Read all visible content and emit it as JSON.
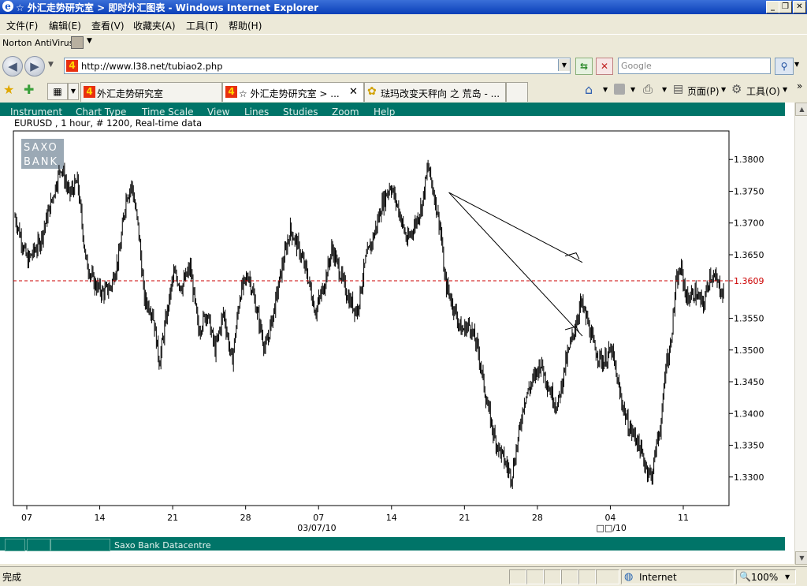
{
  "window": {
    "title": "☆ 外汇走势研究室 > 即时外汇图表 - Windows Internet Explorer",
    "icon": "e"
  },
  "menu": {
    "items": [
      "文件(F)",
      "编辑(E)",
      "查看(V)",
      "收藏夹(A)",
      "工具(T)",
      "帮助(H)"
    ]
  },
  "norton": {
    "label": "Norton AntiVirus"
  },
  "address": {
    "url": "http://www.l38.net/tubiao2.php",
    "search_placeholder": "Google"
  },
  "tabs": [
    {
      "label": "外汇走势研究室",
      "active": false,
      "favicon": "4"
    },
    {
      "label": "☆ 外汇走势研究室 > ...",
      "active": true,
      "favicon": "4"
    },
    {
      "label": "琺玛改变天秤向 之 荒岛 - ...",
      "active": false,
      "favicon": "✿"
    }
  ],
  "right_toolbar": {
    "page_label": "页面(P)",
    "tools_label": "工具(O)"
  },
  "chart_menu": [
    "Instrument",
    "Chart Type",
    "Time Scale",
    "View",
    "Lines",
    "Studies",
    "Zoom",
    "Help"
  ],
  "chart_info": "EURUSD , 1 hour, # 1200, Real-time data",
  "watermark": [
    "SAXO",
    "BANK"
  ],
  "bottom_bar": {
    "label": "Saxo Bank Datacentre"
  },
  "status": {
    "text": "完成",
    "zone": "Internet",
    "zoom": "100%"
  },
  "chart_data": {
    "type": "ohlc",
    "instrument": "EURUSD",
    "xlabel_months": [
      {
        "label": "03/07/10",
        "tick": "07"
      },
      {
        "label": "□□/10",
        "tick": "04"
      }
    ],
    "x_ticks": [
      "07",
      "14",
      "21",
      "28",
      "07",
      "14",
      "21",
      "28",
      "04",
      "11"
    ],
    "y_ticks": [
      1.38,
      1.375,
      1.37,
      1.365,
      1.355,
      1.35,
      1.345,
      1.34,
      1.335,
      1.33
    ],
    "y_tick_labels": [
      "1.3800",
      "1.3750",
      "1.3700",
      "1.3650",
      "1.3550",
      "1.3500",
      "1.3450",
      "1.3400",
      "1.3350",
      "1.3300"
    ],
    "ylim": [
      1.3255,
      1.3845
    ],
    "current_price": 1.3609,
    "current_price_label": "1.3609",
    "current_price_color": "#cc0000",
    "series": [
      {
        "x": 0,
        "y": 1.371
      },
      {
        "x": 1.5,
        "y": 1.364
      },
      {
        "x": 3,
        "y": 1.367
      },
      {
        "x": 4.5,
        "y": 1.374
      },
      {
        "x": 5.5,
        "y": 1.379
      },
      {
        "x": 6.5,
        "y": 1.3745
      },
      {
        "x": 7.5,
        "y": 1.3765
      },
      {
        "x": 8.5,
        "y": 1.364
      },
      {
        "x": 9.5,
        "y": 1.3605
      },
      {
        "x": 10.5,
        "y": 1.359
      },
      {
        "x": 11.5,
        "y": 1.36
      },
      {
        "x": 12.5,
        "y": 1.365
      },
      {
        "x": 13.3,
        "y": 1.374
      },
      {
        "x": 14,
        "y": 1.376
      },
      {
        "x": 14.8,
        "y": 1.369
      },
      {
        "x": 15.5,
        "y": 1.358
      },
      {
        "x": 16.5,
        "y": 1.356
      },
      {
        "x": 17.3,
        "y": 1.348
      },
      {
        "x": 18,
        "y": 1.354
      },
      {
        "x": 19,
        "y": 1.362
      },
      {
        "x": 20,
        "y": 1.36
      },
      {
        "x": 21,
        "y": 1.363
      },
      {
        "x": 22,
        "y": 1.353
      },
      {
        "x": 23,
        "y": 1.356
      },
      {
        "x": 24,
        "y": 1.35
      },
      {
        "x": 25,
        "y": 1.356
      },
      {
        "x": 26,
        "y": 1.348
      },
      {
        "x": 27,
        "y": 1.359
      },
      {
        "x": 28,
        "y": 1.362
      },
      {
        "x": 29,
        "y": 1.356
      },
      {
        "x": 30,
        "y": 1.35
      },
      {
        "x": 31,
        "y": 1.356
      },
      {
        "x": 32,
        "y": 1.363
      },
      {
        "x": 33,
        "y": 1.369
      },
      {
        "x": 34,
        "y": 1.366
      },
      {
        "x": 35,
        "y": 1.362
      },
      {
        "x": 36,
        "y": 1.356
      },
      {
        "x": 37,
        "y": 1.36
      },
      {
        "x": 38,
        "y": 1.366
      },
      {
        "x": 39,
        "y": 1.362
      },
      {
        "x": 40,
        "y": 1.358
      },
      {
        "x": 41,
        "y": 1.356
      },
      {
        "x": 42,
        "y": 1.364
      },
      {
        "x": 43,
        "y": 1.368
      },
      {
        "x": 44,
        "y": 1.373
      },
      {
        "x": 45,
        "y": 1.376
      },
      {
        "x": 46,
        "y": 1.372
      },
      {
        "x": 47,
        "y": 1.367
      },
      {
        "x": 48,
        "y": 1.37
      },
      {
        "x": 48.8,
        "y": 1.373
      },
      {
        "x": 49.5,
        "y": 1.379
      },
      {
        "x": 50.3,
        "y": 1.374
      },
      {
        "x": 51,
        "y": 1.369
      },
      {
        "x": 51.5,
        "y": 1.361
      },
      {
        "x": 52.5,
        "y": 1.357
      },
      {
        "x": 53.5,
        "y": 1.353
      },
      {
        "x": 54.5,
        "y": 1.354
      },
      {
        "x": 55.5,
        "y": 1.35
      },
      {
        "x": 56.5,
        "y": 1.342
      },
      {
        "x": 57.5,
        "y": 1.336
      },
      {
        "x": 58.5,
        "y": 1.333
      },
      {
        "x": 59.5,
        "y": 1.33
      },
      {
        "x": 60.3,
        "y": 1.336
      },
      {
        "x": 61,
        "y": 1.342
      },
      {
        "x": 62,
        "y": 1.345
      },
      {
        "x": 63,
        "y": 1.348
      },
      {
        "x": 64,
        "y": 1.344
      },
      {
        "x": 65,
        "y": 1.341
      },
      {
        "x": 66,
        "y": 1.348
      },
      {
        "x": 67,
        "y": 1.353
      },
      {
        "x": 67.8,
        "y": 1.3575
      },
      {
        "x": 68.5,
        "y": 1.355
      },
      {
        "x": 69.5,
        "y": 1.35
      },
      {
        "x": 70.5,
        "y": 1.348
      },
      {
        "x": 71.5,
        "y": 1.35
      },
      {
        "x": 72.5,
        "y": 1.343
      },
      {
        "x": 73.5,
        "y": 1.338
      },
      {
        "x": 74.5,
        "y": 1.336
      },
      {
        "x": 75.5,
        "y": 1.332
      },
      {
        "x": 76.3,
        "y": 1.33
      },
      {
        "x": 77,
        "y": 1.336
      },
      {
        "x": 77.5,
        "y": 1.339
      },
      {
        "x": 78,
        "y": 1.348
      },
      {
        "x": 78.5,
        "y": 1.35
      },
      {
        "x": 79.2,
        "y": 1.36
      },
      {
        "x": 79.8,
        "y": 1.363
      },
      {
        "x": 80.5,
        "y": 1.358
      },
      {
        "x": 81.5,
        "y": 1.359
      },
      {
        "x": 82.5,
        "y": 1.357
      },
      {
        "x": 83.3,
        "y": 1.362
      },
      {
        "x": 84,
        "y": 1.361
      },
      {
        "x": 84.8,
        "y": 1.359
      }
    ],
    "trendlines": [
      {
        "x1": 52,
        "y1": 1.3748,
        "x2": 68,
        "y2": 1.3638,
        "arrow": true
      },
      {
        "x1": 52,
        "y1": 1.3748,
        "x2": 68,
        "y2": 1.3522,
        "arrow": true
      }
    ],
    "x_max": 85
  }
}
